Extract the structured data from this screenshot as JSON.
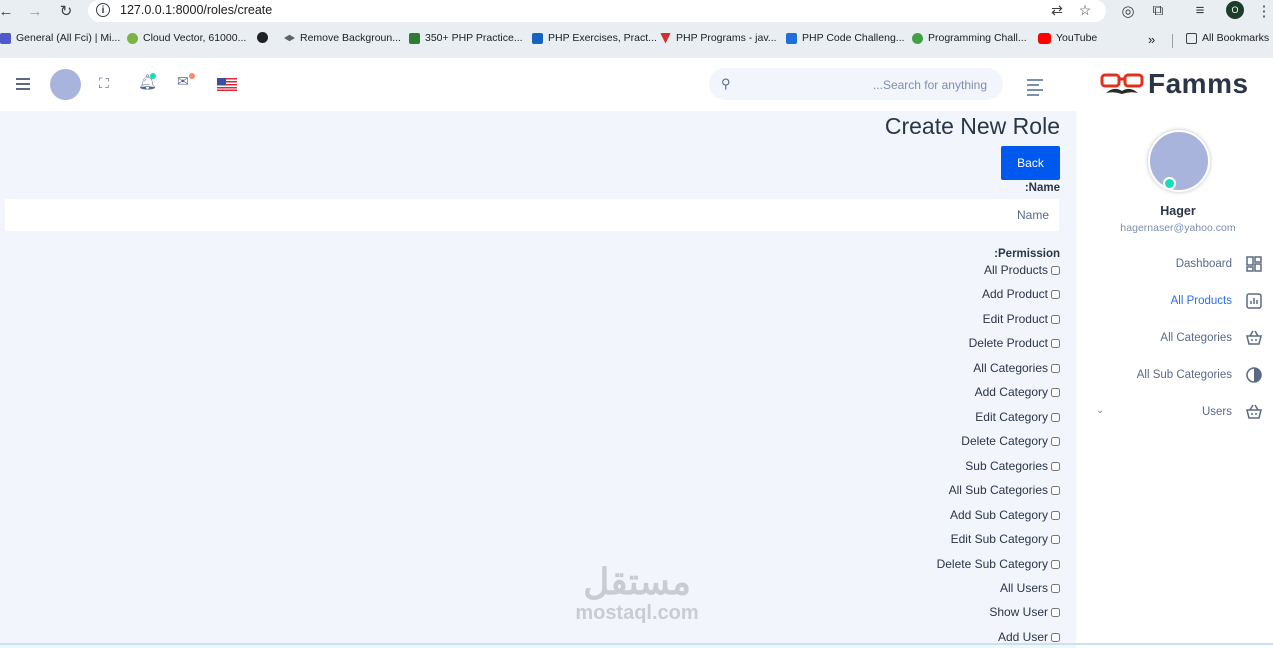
{
  "browser": {
    "url": "127.0.0.1:8000/roles/create",
    "bookmarks": [
      {
        "label": "General (All Fci) | Mi...",
        "icon": "teams-icon"
      },
      {
        "label": "Cloud Vector, 61000...",
        "icon": "cloud-icon"
      },
      {
        "label": "",
        "icon": "globe-icon"
      },
      {
        "label": "Remove Backgroun...",
        "icon": "remove-bg-icon"
      },
      {
        "label": "350+ PHP Practice...",
        "icon": "php-practice-icon"
      },
      {
        "label": "PHP Exercises, Pract...",
        "icon": "ts-icon"
      },
      {
        "label": "PHP Programs - jav...",
        "icon": "tpoint-icon"
      },
      {
        "label": "PHP Code Challeng...",
        "icon": "play-icon"
      },
      {
        "label": "Programming Chall...",
        "icon": "chall-icon"
      },
      {
        "label": "YouTube",
        "icon": "youtube-icon"
      }
    ],
    "all_bookmarks": "All Bookmarks",
    "profile_initial": "O"
  },
  "header": {
    "search_placeholder": "Search for anything..."
  },
  "sidebar": {
    "brand": "Famms",
    "user_name": "Hager",
    "user_email": "hagernaser@yahoo.com",
    "items": [
      {
        "label": "Dashboard",
        "icon": "dashboard-grid-icon",
        "active": false
      },
      {
        "label": "All Products",
        "icon": "chart-bar-icon",
        "active": true
      },
      {
        "label": "All Categories",
        "icon": "basket-icon",
        "active": false
      },
      {
        "label": "All Sub Categories",
        "icon": "half-circle-icon",
        "active": false
      },
      {
        "label": "Users",
        "icon": "basket-icon",
        "active": false
      }
    ]
  },
  "form": {
    "title": "Create New Role",
    "back_label": "Back",
    "name_label": ":Name",
    "name_placeholder": "Name",
    "permission_label": ":Permission",
    "permissions": [
      "All Products",
      "Add Product",
      "Edit Product",
      "Delete Product",
      "All Categories",
      "Add Category",
      "Edit Category",
      "Delete Category",
      "Sub Categories",
      "All Sub Categories",
      "Add Sub Category",
      "Edit Sub Category",
      "Delete Sub Category",
      "All Users",
      "Show User",
      "Add User"
    ]
  },
  "watermark": {
    "arabic": "مستقل",
    "latin": "mostaql.com"
  },
  "colors": {
    "accent": "#0059ee",
    "active_link": "#2a6df4",
    "page_bg": "#f2f5fc",
    "online": "#13deb9"
  }
}
